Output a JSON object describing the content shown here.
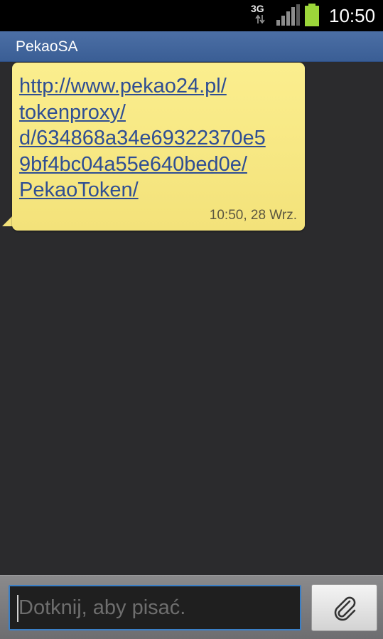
{
  "status_bar": {
    "network": "3G",
    "signal_icon": "signal-bars-icon",
    "battery_icon": "battery-icon",
    "time": "10:50"
  },
  "header": {
    "title": "PekaoSA"
  },
  "messages": [
    {
      "text": "http://www.pekao24.pl/\ntokenproxy/\nd/634868a34e69322370e5\n9bf4bc04a55e640bed0e/\nPekaoToken/",
      "time": "10:50, 28 Wrz."
    }
  ],
  "composer": {
    "placeholder": "Dotknij, aby pisać.",
    "attach_icon": "paperclip-icon"
  },
  "colors": {
    "status_bar": "#000000",
    "title_bar": "#3f6399",
    "background": "#2b2b2d",
    "bubble": "#f8e984",
    "link": "#2f4e93",
    "input_border": "#3a7fc6",
    "battery": "#9cd63a"
  }
}
